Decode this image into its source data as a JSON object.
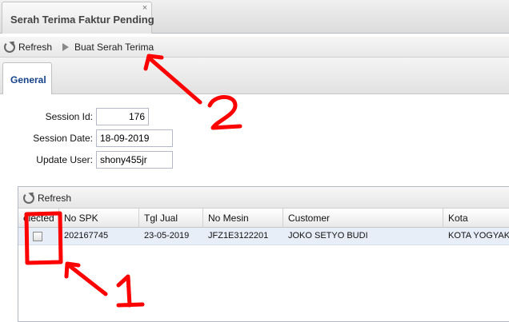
{
  "window": {
    "tab_title": "Serah Terima Faktur Pending",
    "close_glyph": "×"
  },
  "toolbar": {
    "refresh_label": "Refresh",
    "buat_label": "Buat Serah Terima"
  },
  "subtab": {
    "label": "General"
  },
  "form": {
    "session_id_label": "Session Id:",
    "session_id_value": "176",
    "session_date_label": "Session Date:",
    "session_date_value": "18-09-2019",
    "update_user_label": "Update User:",
    "update_user_value": "shony455jr"
  },
  "grid": {
    "refresh_label": "Refresh",
    "columns": [
      "elected",
      "No SPK",
      "Tgl Jual",
      "No Mesin",
      "Customer",
      "Kota"
    ],
    "rows": [
      {
        "selected": false,
        "no_spk": "202167745",
        "tgl_jual": "23-05-2019",
        "no_mesin": "JFZ1E3122201",
        "customer": "JOKO SETYO BUDI",
        "kota": "KOTA YOGYAKA"
      }
    ]
  },
  "annotations": {
    "label_1": "1",
    "label_2": "2",
    "color": "#ff0000"
  }
}
